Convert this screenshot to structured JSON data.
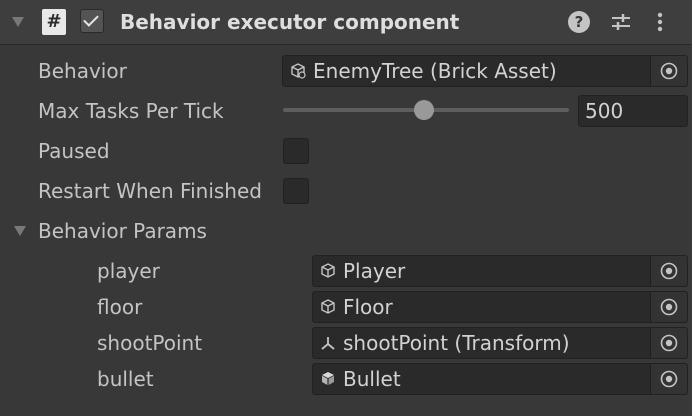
{
  "component": {
    "title": "Behavior executor component",
    "script_icon_glyph": "#",
    "enabled": true,
    "icons": [
      "foldout-arrow-icon",
      "script-icon",
      "help-icon",
      "settings-sliders-icon",
      "more-vertical-icon"
    ]
  },
  "fields": {
    "behavior": {
      "label": "Behavior",
      "value": "EnemyTree (Brick Asset)",
      "icon": "brick-asset-icon"
    },
    "max_tasks": {
      "label": "Max Tasks Per Tick",
      "value": "500",
      "slider_fraction": 0.49
    },
    "paused": {
      "label": "Paused",
      "checked": false
    },
    "restart": {
      "label": "Restart When Finished",
      "checked": false
    }
  },
  "params": {
    "label": "Behavior Params",
    "items": [
      {
        "name": "player",
        "value": "Player",
        "icon": "prefab-outline-icon"
      },
      {
        "name": "floor",
        "value": "Floor",
        "icon": "prefab-outline-icon"
      },
      {
        "name": "shootPoint",
        "value": "shootPoint (Transform)",
        "icon": "transform-icon"
      },
      {
        "name": "bullet",
        "value": "Bullet",
        "icon": "prefab-filled-icon"
      }
    ]
  },
  "colors": {
    "background": "#383838",
    "header": "#3e3e3e",
    "field": "#2a2a2a",
    "text": "#c4c4c4"
  }
}
